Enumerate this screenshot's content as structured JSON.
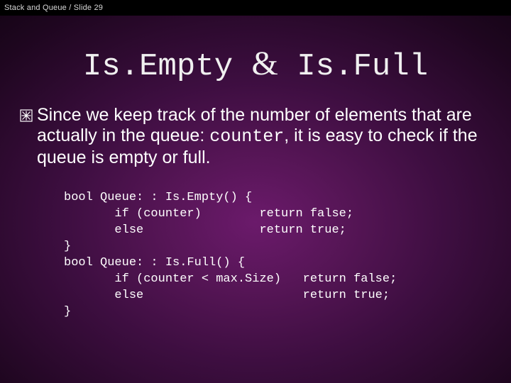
{
  "topbar": {
    "text": "Stack and Queue / Slide 29"
  },
  "title": {
    "left": "Is.Empty",
    "amp": "&",
    "right": " Is.Full"
  },
  "bullet": {
    "t1": "Since we keep track of the number of elements that are actually in the queue: ",
    "mono": "counter",
    "t2": ", it is easy to check if the queue is empty or full."
  },
  "code": {
    "l1": "bool Queue: : Is.Empty() {",
    "l2": "       if (counter)        return false;",
    "l3": "       else                return true;",
    "l4": "}",
    "l5": "bool Queue: : Is.Full() {",
    "l6": "       if (counter < max.Size)   return false;",
    "l7": "       else                      return true;",
    "l8": "}"
  }
}
